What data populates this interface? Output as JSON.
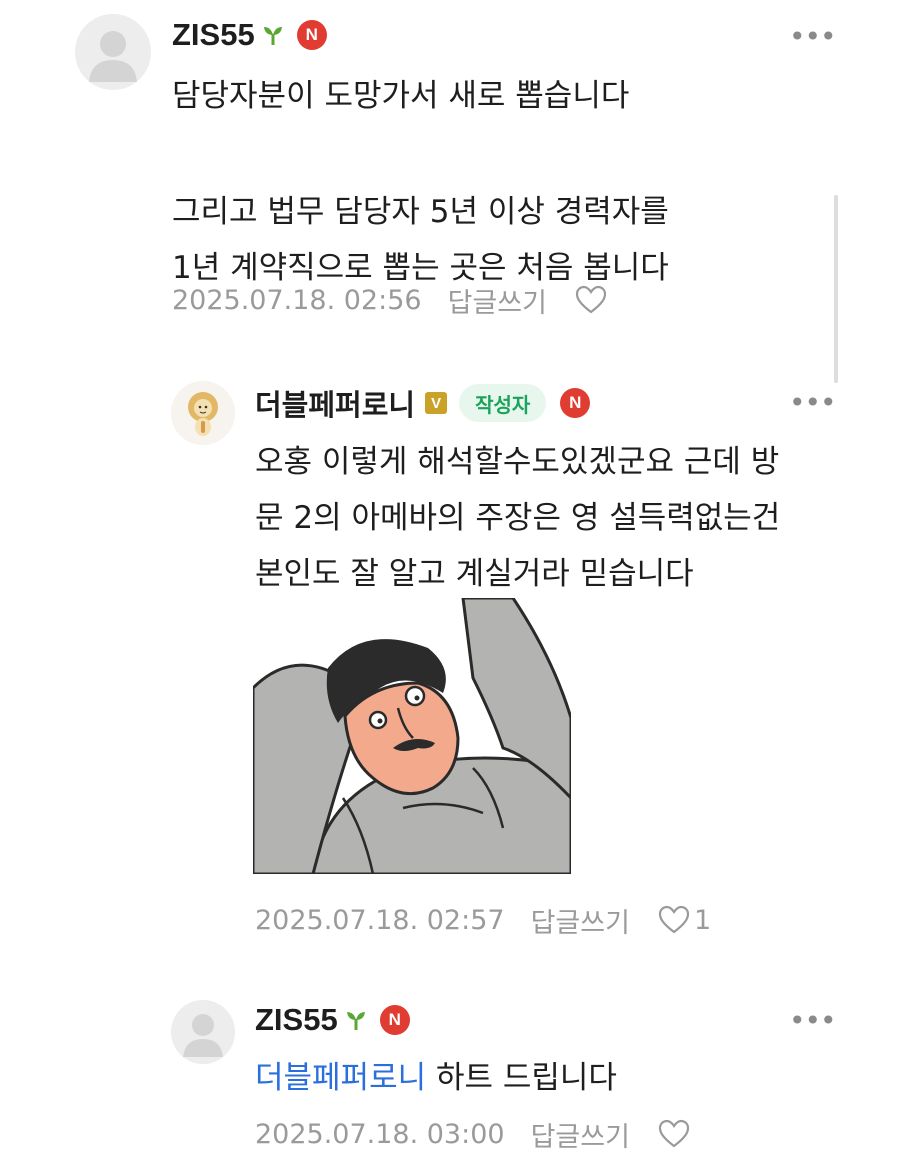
{
  "comments": [
    {
      "nickname": "ZIS55",
      "level_icon": "sprout-icon",
      "n_badge": "N",
      "lines": [
        "담당자분이 도망가서 새로 뽑습니다",
        "",
        "그리고 법무 담당자 5년 이상 경력자를",
        "1년 계약직으로 뽑는 곳은 처음 봅니다"
      ],
      "date": "2025.07.18. 02:56",
      "reply_label": "답글쓰기",
      "like_count": ""
    },
    {
      "nickname": "더블페퍼로니",
      "level_icon": "verified-v-icon",
      "v_badge": "V",
      "author_badge": "작성자",
      "n_badge": "N",
      "lines": [
        "오홍 이렇게 해석할수도있겠군요 근데 방",
        "문 2의 아메바의 주장은 영 설득력없는건",
        "본인도 잘 알고 계실거라 믿습니다"
      ],
      "sticker": "cartoon-man-relaxing-sticker",
      "date": "2025.07.18. 02:57",
      "reply_label": "답글쓰기",
      "like_count": "1"
    },
    {
      "nickname": "ZIS55",
      "level_icon": "sprout-icon",
      "n_badge": "N",
      "mention": "더블페퍼로니",
      "text": " 하트 드립니다",
      "date": "2025.07.18. 03:00",
      "reply_label": "답글쓰기",
      "like_count": ""
    }
  ],
  "more_label": "•••",
  "colors": {
    "n_badge": "#e03c31",
    "author_badge_text": "#1aa35b",
    "author_badge_bg": "#e8f7ed",
    "mention": "#2a6fdb",
    "meta_text": "#9a9a9a",
    "sprout": "#5aa833",
    "v_badge": "#c9a227"
  }
}
